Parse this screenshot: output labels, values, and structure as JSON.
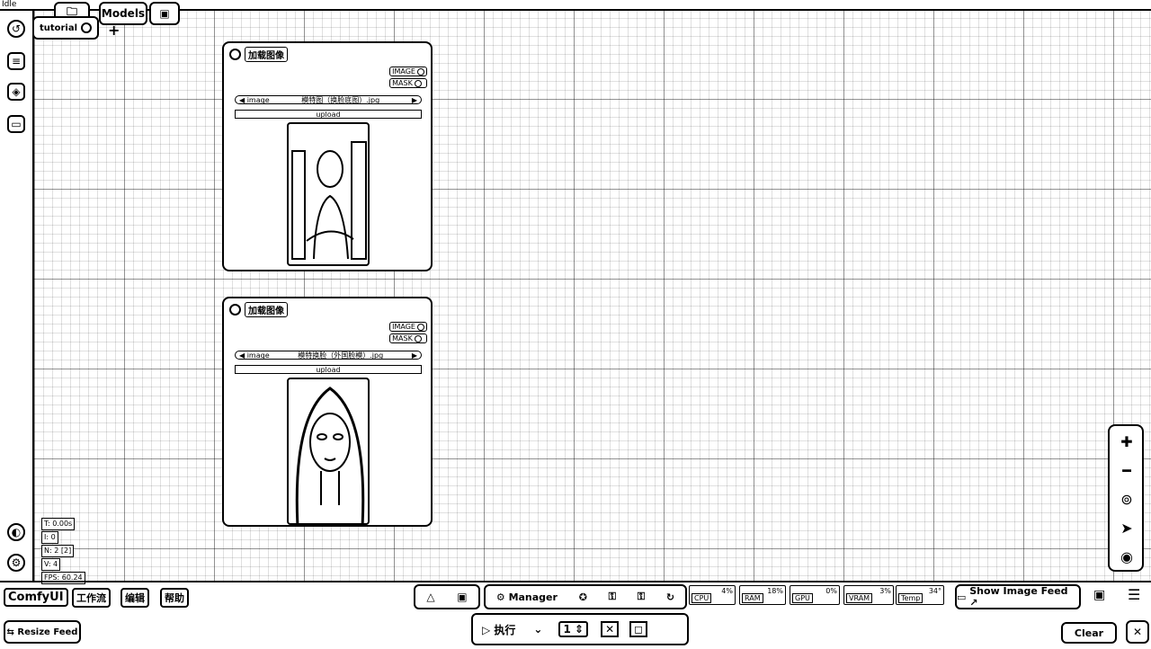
{
  "status": "Idle",
  "header": {
    "models_tab": "Models",
    "workflow_tab": "tutorial"
  },
  "nodes": [
    {
      "title": "加载图像",
      "outputs": [
        "IMAGE",
        "MASK"
      ],
      "image_label": "image",
      "image_value": "模特图（换脸底图）.jpg",
      "upload_label": "upload"
    },
    {
      "title": "加载图像",
      "outputs": [
        "IMAGE",
        "MASK"
      ],
      "image_label": "image",
      "image_value": "模特换脸（外国脸模）.jpg",
      "upload_label": "upload"
    }
  ],
  "menubar": {
    "brand": "ComfyUI",
    "items": [
      "工作流",
      "编辑",
      "帮助"
    ]
  },
  "toolbar": {
    "manager": "Manager",
    "show_image_feed": "Show Image Feed ↗",
    "resize_feed": "Resize Feed",
    "clear": "Clear",
    "run": "执行"
  },
  "monitors": [
    {
      "label": "CPU",
      "value": "4%"
    },
    {
      "label": "RAM",
      "value": "18%"
    },
    {
      "label": "GPU",
      "value": "0%"
    },
    {
      "label": "VRAM",
      "value": "3%"
    },
    {
      "label": "Temp",
      "value": "34°"
    }
  ],
  "canvas_stats": [
    "T: 0.00s",
    "I: 0",
    "N: 2 [2]",
    "V: 4",
    "FPS: 60.24"
  ],
  "icons": {
    "sidebar": [
      "history-icon",
      "queue-icon",
      "cube-icon",
      "folder-icon"
    ],
    "sidebar_bottom": [
      "theme-icon",
      "settings-icon"
    ],
    "zoom": [
      "zoom-in-icon",
      "zoom-out-icon",
      "fit-icon",
      "pointer-icon",
      "eye-icon"
    ]
  }
}
